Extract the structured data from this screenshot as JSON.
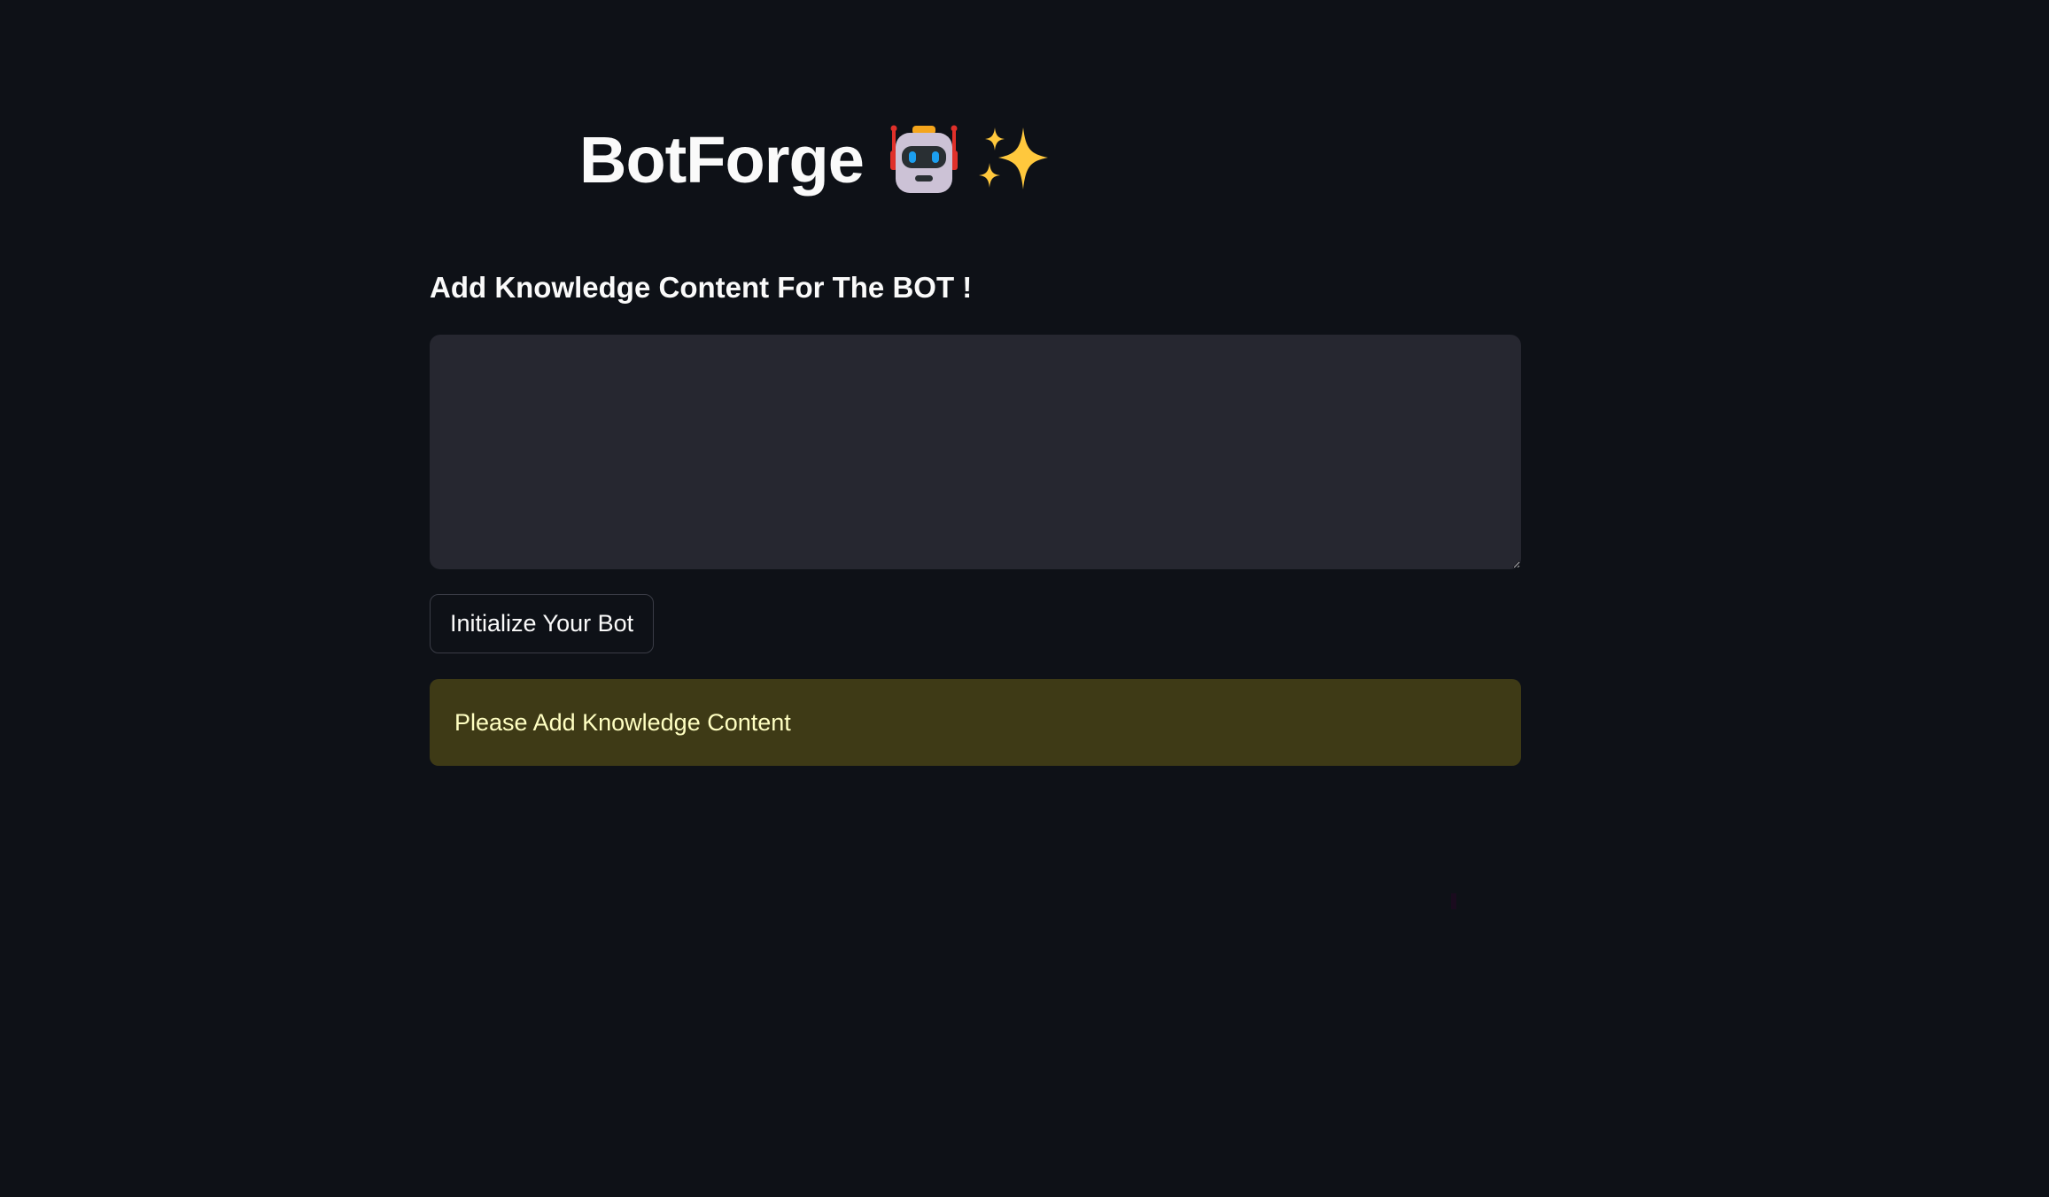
{
  "header": {
    "title": "BotForge",
    "icons": [
      "robot-icon",
      "sparkles-icon"
    ]
  },
  "knowledge": {
    "heading": "Add Knowledge Content For The BOT !",
    "textarea_value": "",
    "textarea_placeholder": ""
  },
  "actions": {
    "initialize_label": "Initialize Your Bot"
  },
  "alert": {
    "message": "Please Add Knowledge Content",
    "type": "warning"
  },
  "colors": {
    "background": "#0e1117",
    "input_background": "#262730",
    "warning_background": "#3e3a16",
    "warning_text": "#ffffc2",
    "text": "#fafafa"
  }
}
